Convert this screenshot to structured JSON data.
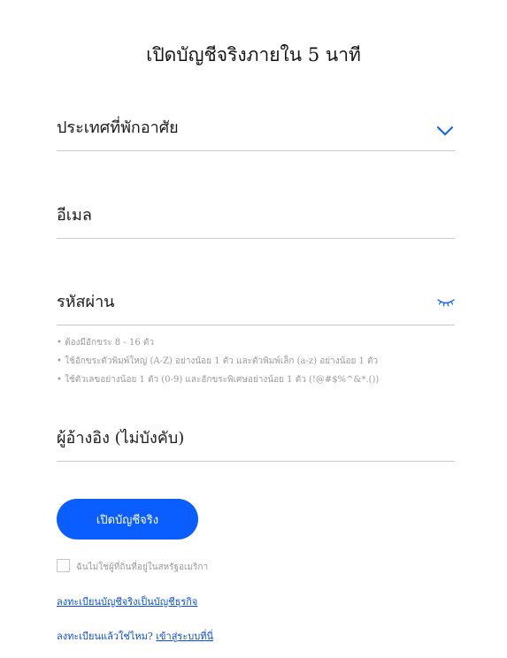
{
  "page": {
    "title": "เปิดบัญชีจริงภายใน 5 นาที"
  },
  "form": {
    "country_label": "ประเทศที่พักอาศัย",
    "email_label": "อีเมล",
    "password_label": "รหัสผ่าน",
    "password_rules": [
      "• ต้องมีอักขระ 8 - 16 ตัว",
      "• ใช้อักขระตัวพิมพ์ใหญ่ (A-Z) อย่างน้อย 1 ตัว และตัวพิมพ์เล็ก (a-z) อย่างน้อย 1 ตัว",
      "• ใช้ตัวเลขอย่างน้อย 1 ตัว (0-9) และอักขระพิเศษอย่างน้อย 1 ตัว (!@#$%^&*.())"
    ],
    "referral_label": "ผู้อ้างอิง (ไม่บังคับ)",
    "submit_label": "เปิดบัญชีจริง",
    "us_checkbox_label": "ฉันไม่ใช่ผู้ที่ถิ่นที่อยู่ในสหรัฐอเมริกา"
  },
  "links": {
    "business_account": "ลงทะเบียนบัญชีจริงเป็นบัญชีธุรกิจ",
    "already_registered": "ลงทะเบียนแล้วใช่ไหม?",
    "login": "เข้าสู่ระบบที่นี่"
  },
  "colors": {
    "accent": "#0a5eff",
    "link": "#0a4fd6",
    "hint_text": "#9a9a9a",
    "divider": "#c8c8c8"
  },
  "icons": {
    "country_dropdown": "chevron-down-icon",
    "password_toggle": "eye-closed-icon"
  }
}
